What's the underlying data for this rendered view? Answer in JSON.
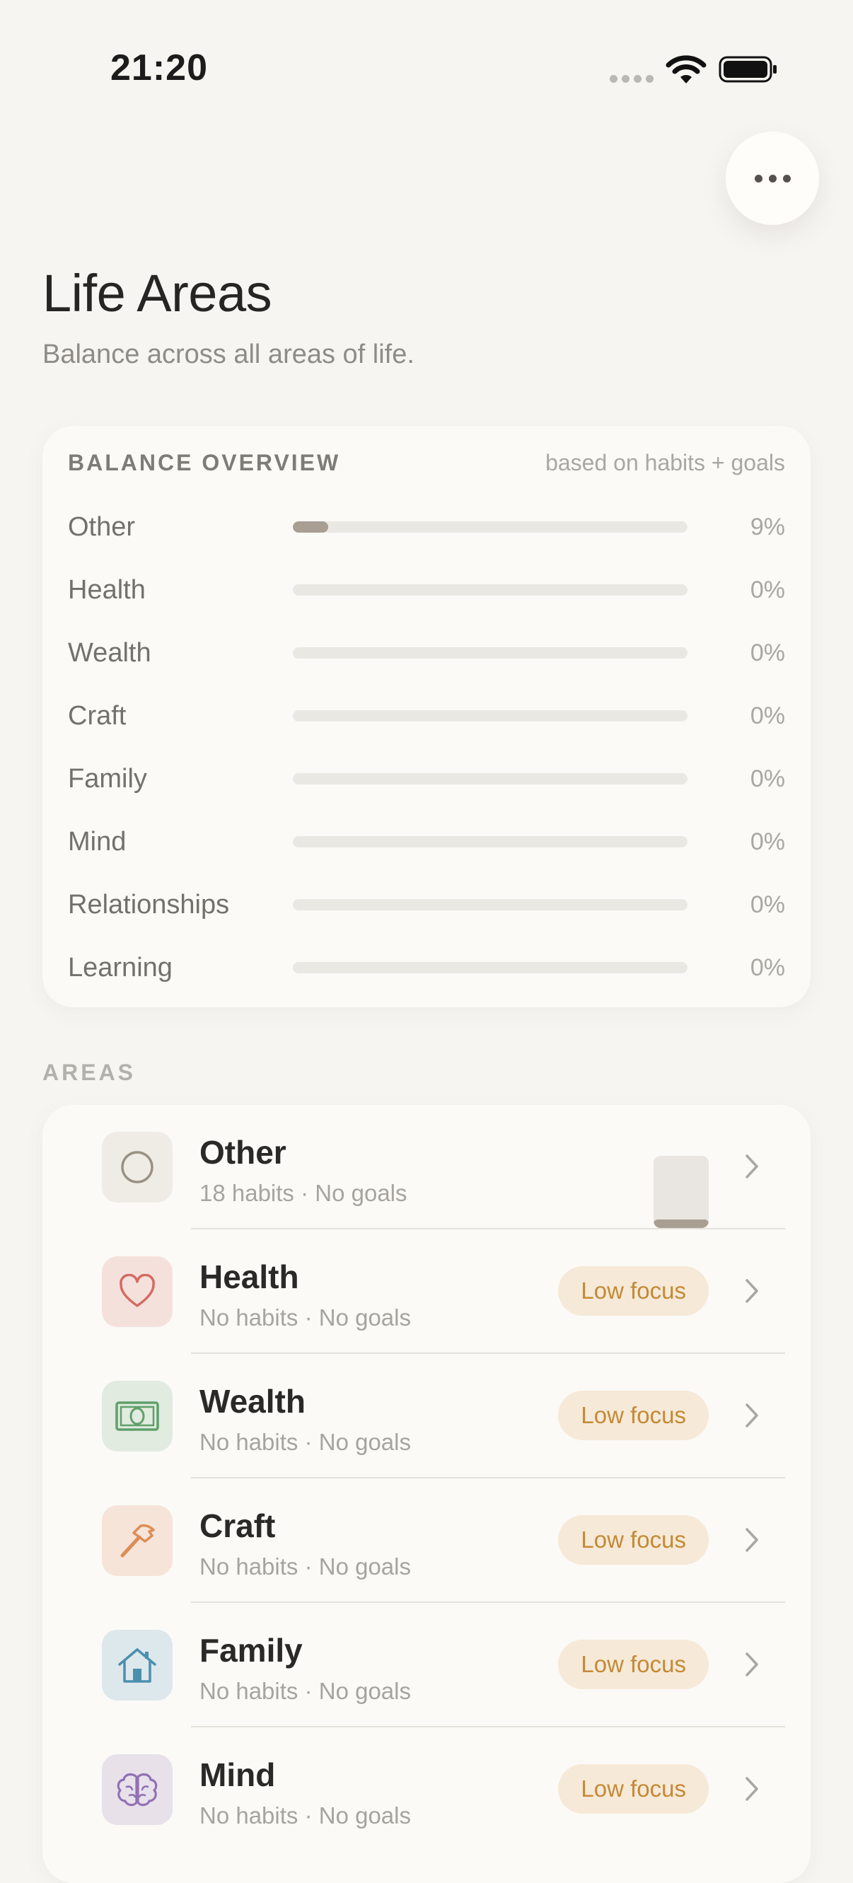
{
  "status_bar": {
    "time": "21:20"
  },
  "header": {
    "title": "Life Areas",
    "subtitle": "Balance across all areas of life."
  },
  "overview": {
    "title": "BALANCE OVERVIEW",
    "note": "based on habits + goals",
    "rows": [
      {
        "label": "Other",
        "pct_text": "9%",
        "value": 0.09
      },
      {
        "label": "Health",
        "pct_text": "0%",
        "value": 0
      },
      {
        "label": "Wealth",
        "pct_text": "0%",
        "value": 0
      },
      {
        "label": "Craft",
        "pct_text": "0%",
        "value": 0
      },
      {
        "label": "Family",
        "pct_text": "0%",
        "value": 0
      },
      {
        "label": "Mind",
        "pct_text": "0%",
        "value": 0
      },
      {
        "label": "Relationships",
        "pct_text": "0%",
        "value": 0
      },
      {
        "label": "Learning",
        "pct_text": "0%",
        "value": 0
      }
    ]
  },
  "areas_section": {
    "label": "AREAS",
    "items": [
      {
        "name": "Other",
        "meta": "18 habits · No goals",
        "icon": "circle-icon",
        "badge": "",
        "tint": "#efece5",
        "accent": "#9a9184"
      },
      {
        "name": "Health",
        "meta": "No habits · No goals",
        "icon": "heart-icon",
        "badge": "Low focus",
        "tint": "#f5e1dc",
        "accent": "#d46b63"
      },
      {
        "name": "Wealth",
        "meta": "No habits · No goals",
        "icon": "banknote-icon",
        "badge": "Low focus",
        "tint": "#e1ebe0",
        "accent": "#5fa06a"
      },
      {
        "name": "Craft",
        "meta": "No habits · No goals",
        "icon": "hammer-icon",
        "badge": "Low focus",
        "tint": "#f6e4d8",
        "accent": "#dd8d57"
      },
      {
        "name": "Family",
        "meta": "No habits · No goals",
        "icon": "house-icon",
        "badge": "Low focus",
        "tint": "#dde8ec",
        "accent": "#4b8fae"
      },
      {
        "name": "Mind",
        "meta": "No habits · No goals",
        "icon": "brain-icon",
        "badge": "Low focus",
        "tint": "#e8e1ea",
        "accent": "#9270b5"
      }
    ]
  }
}
